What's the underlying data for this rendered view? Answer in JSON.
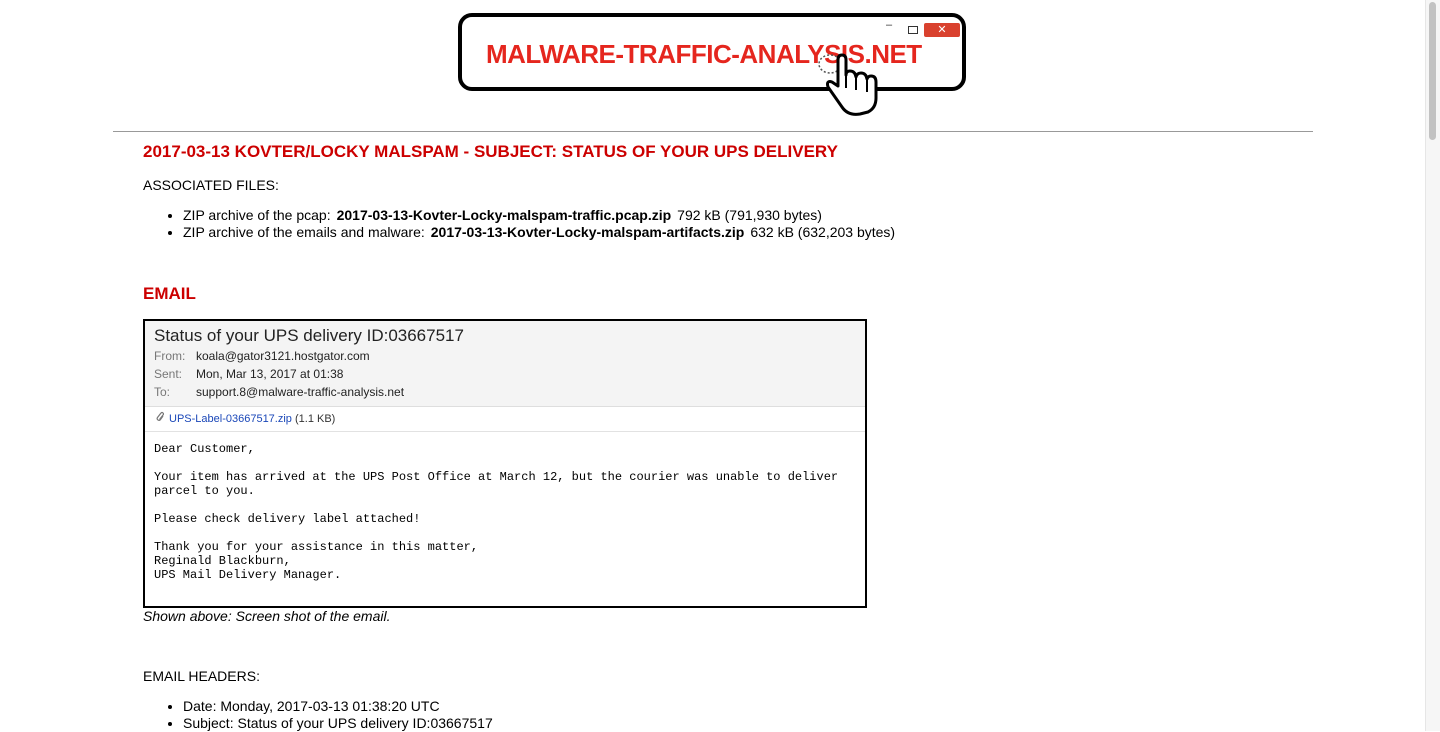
{
  "logo": {
    "text": "MALWARE-TRAFFIC-ANALYSIS.NET",
    "min": "–",
    "close": "✕"
  },
  "page_title": "2017-03-13 KOVTER/LOCKY MALSPAM - SUBJECT: STATUS OF YOUR UPS DELIVERY",
  "associated_files": {
    "label": "ASSOCIATED FILES:",
    "items": [
      {
        "prefix": "ZIP archive of the pcap:",
        "file": "2017-03-13-Kovter-Locky-malspam-traffic.pcap.zip",
        "size": "792 kB (791,930 bytes)"
      },
      {
        "prefix": "ZIP archive of the emails and malware:",
        "file": "2017-03-13-Kovter-Locky-malspam-artifacts.zip",
        "size": "632 kB (632,203 bytes)"
      }
    ]
  },
  "email_section_title": "EMAIL",
  "email": {
    "subject": "Status of your UPS delivery ID:03667517",
    "from_key": "From:",
    "from": "koala@gator3121.hostgator.com",
    "sent_key": "Sent:",
    "sent": "Mon, Mar 13, 2017 at 01:38",
    "to_key": "To:",
    "to": "support.8@malware-traffic-analysis.net",
    "attachment": "UPS-Label-03667517.zip",
    "attachment_size": "(1.1 KB)",
    "body": "Dear Customer,\n\nYour item has arrived at the UPS Post Office at March 12, but the courier was unable to deliver\nparcel to you.\n\nPlease check delivery label attached!\n\nThank you for your assistance in this matter,\nReginald Blackburn,\nUPS Mail Delivery Manager."
  },
  "caption": "Shown above:  Screen shot of the email.",
  "email_headers": {
    "label": "EMAIL HEADERS:",
    "items": [
      "Date:  Monday, 2017-03-13 01:38:20 UTC",
      "Subject:  Status of your UPS delivery ID:03667517"
    ]
  }
}
